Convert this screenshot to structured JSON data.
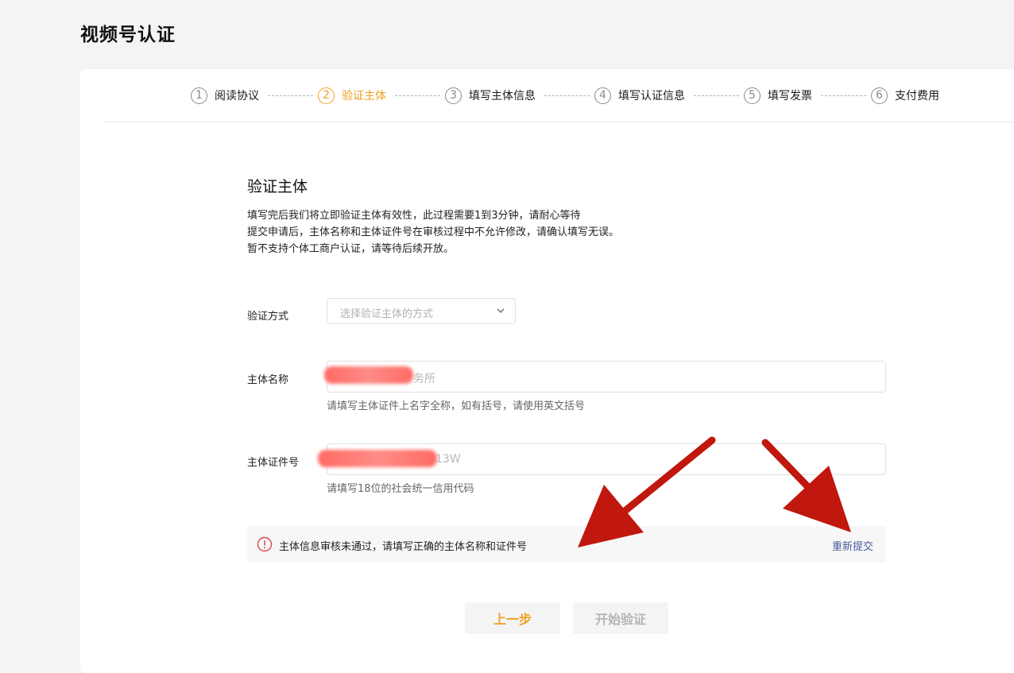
{
  "page": {
    "title": "视频号认证"
  },
  "steps": [
    {
      "num": "1",
      "label": "阅读协议",
      "active": false
    },
    {
      "num": "2",
      "label": "验证主体",
      "active": true
    },
    {
      "num": "3",
      "label": "填写主体信息",
      "active": false
    },
    {
      "num": "4",
      "label": "填写认证信息",
      "active": false
    },
    {
      "num": "5",
      "label": "填写发票",
      "active": false
    },
    {
      "num": "6",
      "label": "支付费用",
      "active": false
    }
  ],
  "section": {
    "title": "验证主体",
    "desc": [
      "填写完后我们将立即验证主体有效性，此过程需要1到3分钟，请耐心等待",
      "提交申请后，主体名称和主体证件号在审核过程中不允许修改，请确认填写无误。",
      "暂不支持个体工商户认证，请等待后续开放。"
    ]
  },
  "form": {
    "method": {
      "label": "验证方式",
      "placeholder": "选择验证主体的方式"
    },
    "name": {
      "label": "主体名称",
      "value": "务所",
      "hint": "请填写主体证件上名字全称，如有括号，请使用英文括号"
    },
    "id_number": {
      "label": "主体证件号",
      "value": "13W",
      "hint": "请填写18位的社会统一信用代码"
    }
  },
  "alert": {
    "message": "主体信息审核未通过，请填写正确的主体名称和证件号",
    "action": "重新提交"
  },
  "buttons": {
    "prev": "上一步",
    "start": "开始验证"
  },
  "colors": {
    "accent": "#f0a020",
    "link": "#4c5a9e",
    "error": "#e04848",
    "annotation_arrow": "#c0170e"
  },
  "icons": {
    "alert": "exclamation-circle-icon",
    "select": "chevron-down-icon"
  }
}
